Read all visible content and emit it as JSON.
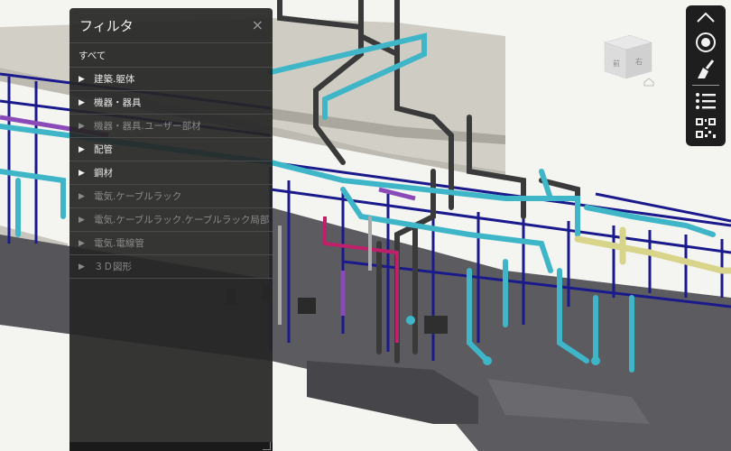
{
  "filter_panel": {
    "title": "フィルタ",
    "close_symbol": "×",
    "all_label": "すべて",
    "items": [
      {
        "label": "建築.躯体",
        "enabled": true
      },
      {
        "label": "機器・器具",
        "enabled": true
      },
      {
        "label": "機器・器具.ユーザー部材",
        "enabled": false
      },
      {
        "label": "配管",
        "enabled": true
      },
      {
        "label": "鋼材",
        "enabled": true
      },
      {
        "label": "電気.ケーブルラック",
        "enabled": false
      },
      {
        "label": "電気.ケーブルラック.ケーブルラック局部",
        "enabled": false
      },
      {
        "label": "電気.電線管",
        "enabled": false
      },
      {
        "label": "３Ｄ図形",
        "enabled": false
      }
    ]
  },
  "viewcube": {
    "face_front": "前",
    "face_right": "右"
  },
  "toolbar": {
    "icons": [
      "chevron-up-icon",
      "target-icon",
      "broom-icon",
      "list-icon",
      "qr-code-icon"
    ]
  },
  "colors": {
    "steel_frame": "#1a1a8c",
    "pipe_cyan": "#3fb6c8",
    "pipe_dark": "#3a3a3a",
    "pipe_yellow": "#d8d48a",
    "pipe_magenta": "#c0206a",
    "pipe_purple": "#8a4ab8",
    "floor_slab": "#5a5a5e",
    "wall": "#c8c6bc"
  }
}
